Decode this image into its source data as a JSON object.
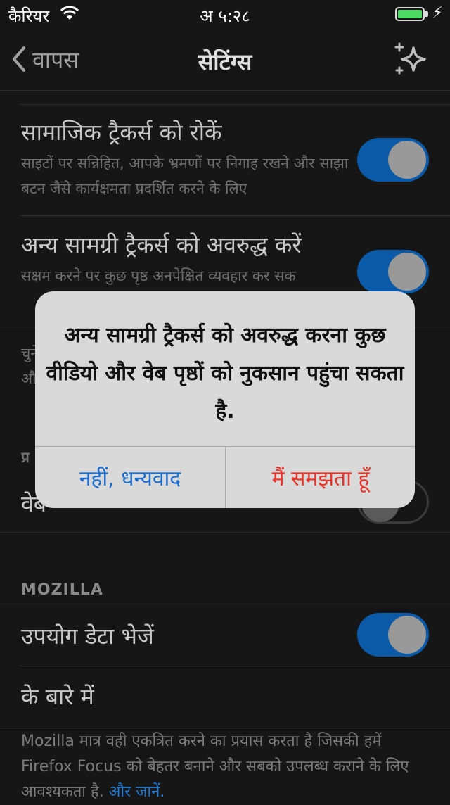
{
  "status_bar": {
    "carrier": "कैरियर",
    "time": "अ ५:२८"
  },
  "nav": {
    "back_label": "वापस",
    "title": "सेटिंग्स"
  },
  "rows": [
    {
      "title": "सामाजिक ट्रैकर्स को रोकें",
      "subtitle": "साइटों पर सन्निहित, आपके भ्रमणों पर निगाह रखने और साझा बटन जैसे कार्यक्षमता प्रदर्शित करने के लिए",
      "toggle_on": true
    },
    {
      "title": "अन्य सामग्री ट्रैकर्स को अवरुद्ध करें",
      "subtitle": "सक्षम करने पर कुछ पृष्ठ अनपेक्षित व्यवहार कर सक",
      "toggle_on": true
    }
  ],
  "partial_rows": {
    "line1": "चुने",
    "line2": "औ",
    "section": "प्र",
    "row": "वेब",
    "toggle_on": false
  },
  "mozilla_section": {
    "header": "MOZILLA",
    "send_usage_label": "उपयोग डेटा भेजें",
    "send_usage_on": true,
    "about_label": "के बारे में"
  },
  "footer": {
    "text": "Mozilla मात्र वही एकत्रित करने का प्रयास करता है जिसकी हमें Firefox Focus को बेहतर बनाने और सबको उपलब्ध कराने के लिए आवश्यकता है.",
    "link": "और जानें."
  },
  "dialog": {
    "message": "अन्य सामग्री ट्रैकर्स को अवरुद्ध करना कुछ वीडियो और वेब पृष्ठों को नुकसान पहुंचा सकता है.",
    "cancel_label": "नहीं, धन्यवाद",
    "confirm_label": "मैं समझता हूँ"
  }
}
